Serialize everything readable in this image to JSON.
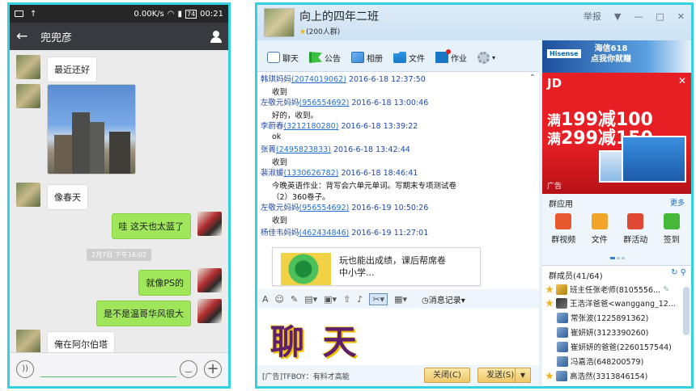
{
  "phone": {
    "status": {
      "speed": "0.00K/s",
      "time": "00:21",
      "battery": "74"
    },
    "nav": {
      "back": "←",
      "title": "兜兜彦"
    },
    "messages": [
      {
        "side": "left",
        "type": "text",
        "text": "最近还好"
      },
      {
        "side": "left",
        "type": "image"
      },
      {
        "side": "left",
        "type": "text",
        "text": "像春天"
      },
      {
        "side": "right",
        "type": "text",
        "text": "哇 这天也太蓝了"
      },
      {
        "type": "time",
        "text": "2月7日 下午16:02"
      },
      {
        "side": "right",
        "type": "text",
        "text": "就像PS的"
      },
      {
        "side": "right",
        "type": "text",
        "text": "是不是温哥华风很大"
      },
      {
        "side": "left",
        "type": "text",
        "text": "俺在阿尔伯塔"
      }
    ]
  },
  "qq": {
    "group_name": "向上的四年二班",
    "member_count": "(200人群)",
    "window_controls": {
      "report": "举报",
      "minimize": "—",
      "maximize": "□",
      "close": "✕"
    },
    "tabs": [
      {
        "label": "聊天",
        "icon": "chat-icon"
      },
      {
        "label": "公告",
        "icon": "notice-icon"
      },
      {
        "label": "相册",
        "icon": "album-icon"
      },
      {
        "label": "文件",
        "icon": "file-icon"
      },
      {
        "label": "作业",
        "icon": "homework-icon"
      }
    ],
    "chat": [
      {
        "name": "韩琪妈妈",
        "qq": "2074019062",
        "time": "2016-6-18 12:37:50",
        "body": "收到"
      },
      {
        "name": "左敬元妈妈",
        "qq": "956554692",
        "time": "2016-6-18 13:00:46",
        "body": "好的，收到。"
      },
      {
        "name": "李蔚春",
        "qq": "3212180280",
        "time": "2016-6-18 13:39:22",
        "body": "ok"
      },
      {
        "name": "张菁",
        "qq": "2495823833",
        "time": "2016-6-18 13:42:44",
        "body": "收到"
      },
      {
        "name": "裴淑媛",
        "qq": "1330626782",
        "time": "2016-6-18 18:46:41",
        "body": "今晚英语作业：背写会六单元单词。写期末专项测试卷",
        "body2": "（2）360卷子。"
      },
      {
        "name": "左敬元妈妈",
        "qq": "956554692",
        "time": "2016-6-19 10:50:26",
        "body": "收到"
      },
      {
        "name": "杨佳韦妈妈",
        "qq": "462434846",
        "time": "2016-6-19 11:27:01",
        "body": ""
      }
    ],
    "preview_text": [
      "玩也能出成绩，课后帮席卷",
      "中小学..."
    ],
    "history_label": "消息记录",
    "input_text": "聊 天",
    "bottom_ad": "[广告]TFBOY：有料才高能",
    "close_button": "关闭(C)",
    "send_button": "发送(S)",
    "ad_top": {
      "brand": "Hisense",
      "promo": "海信618\n点我你就赚"
    },
    "jd_ad": {
      "logo": "JD",
      "line1_pre": "满",
      "line1_big": "199减100",
      "line2_pre": "满",
      "line2_big": "299减150",
      "label": "广告"
    },
    "apps_title": "群应用",
    "apps_more": "更多",
    "apps": [
      {
        "label": "群视频",
        "icon": "video-icon"
      },
      {
        "label": "文件",
        "icon": "folder-icon"
      },
      {
        "label": "群活动",
        "icon": "activity-icon"
      },
      {
        "label": "签到",
        "icon": "signin-icon"
      }
    ],
    "members_title": "群成员(41/64)",
    "members": [
      {
        "name": "班主任张老师(8105556...",
        "role": "owner"
      },
      {
        "name": "王浩洋爸爸<wanggang_12...",
        "role": "admin"
      },
      {
        "name": "常张波(1225891362)",
        "role": "member"
      },
      {
        "name": "崔妍妍(3123390260)",
        "role": "member"
      },
      {
        "name": "崔妍妍的爸爸(2260157544)",
        "role": "member"
      },
      {
        "name": "冯嘉浩(648200579)",
        "role": "member"
      },
      {
        "name": "高浩然(3313846154)",
        "role": "member"
      }
    ]
  }
}
